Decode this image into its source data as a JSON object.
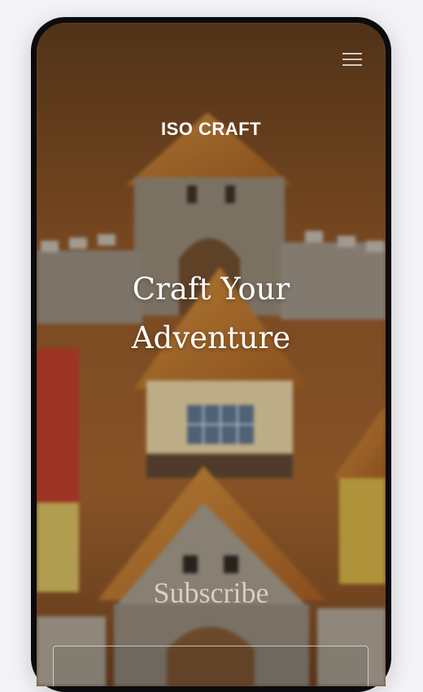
{
  "header": {
    "brand": "ISO CRAFT",
    "menu_icon": "hamburger-menu-icon"
  },
  "hero": {
    "title_line1": "Craft Your",
    "title_line2": "Adventure"
  },
  "subscribe": {
    "heading": "Subscribe",
    "email_placeholder": ""
  },
  "colors": {
    "frame": "#0b0b0d",
    "page_background": "#f4f3f7",
    "text": "#ffffff"
  }
}
